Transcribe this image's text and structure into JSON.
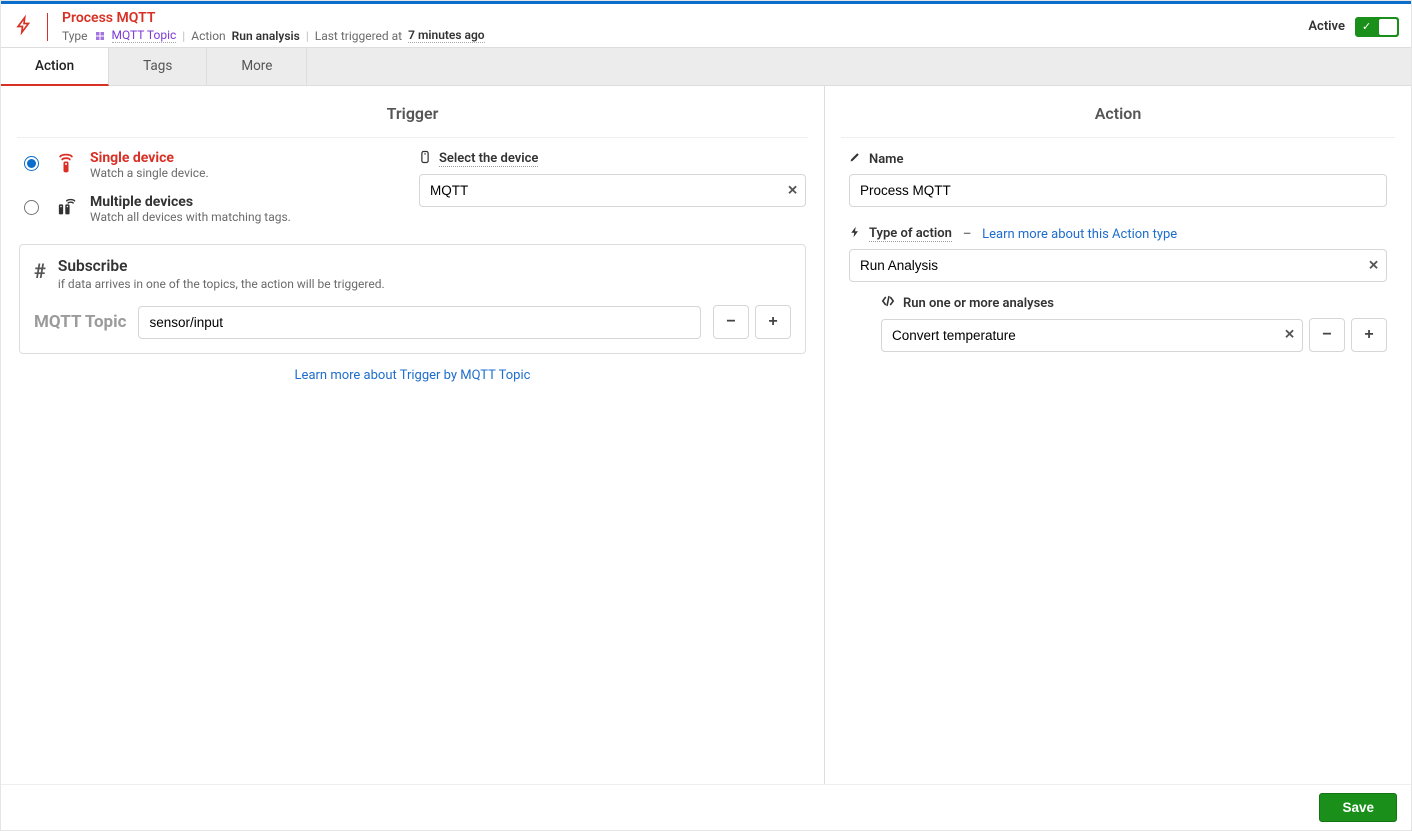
{
  "header": {
    "title": "Process MQTT",
    "type_label": "Type",
    "topic_type": "MQTT Topic",
    "action_label": "Action",
    "action_value": "Run analysis",
    "last_triggered_label": "Last triggered at",
    "last_triggered_value": "7 minutes ago",
    "active_label": "Active"
  },
  "tabs": {
    "action": "Action",
    "tags": "Tags",
    "more": "More"
  },
  "trigger": {
    "section_title": "Trigger",
    "single": {
      "title": "Single device",
      "desc": "Watch a single device."
    },
    "multiple": {
      "title": "Multiple devices",
      "desc": "Watch all devices with matching tags."
    },
    "device_label": "Select the device",
    "device_value": "MQTT",
    "subscribe": {
      "title": "Subscribe",
      "desc": "if data arrives in one of the topics, the action will be triggered.",
      "topic_label": "MQTT Topic",
      "topic_value": "sensor/input"
    },
    "learn_link": "Learn more about Trigger by MQTT Topic"
  },
  "action": {
    "section_title": "Action",
    "name_label": "Name",
    "name_value": "Process MQTT",
    "type_label": "Type of action",
    "type_link": "Learn more about this Action type",
    "type_value": "Run Analysis",
    "analyses_label": "Run one or more analyses",
    "analysis_value": "Convert temperature"
  },
  "footer": {
    "save": "Save"
  }
}
